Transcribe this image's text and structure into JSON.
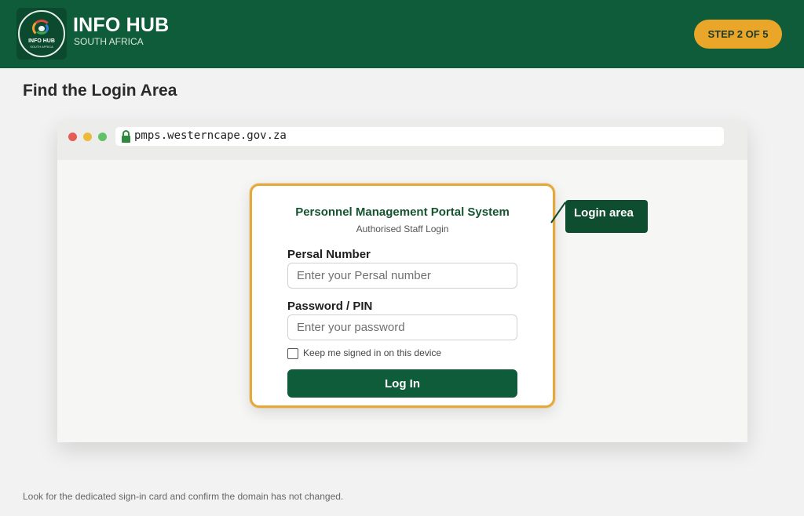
{
  "header": {
    "logo": {
      "icon": "info-hub-logo-icon",
      "text": "INFO HUB",
      "subtext": "SOUTH AFRICA"
    },
    "title": "INFO HUB",
    "subtitle": "SOUTH AFRICA",
    "step_badge": "STEP 2 OF 5"
  },
  "page": {
    "title": "Find the Login Area",
    "footer_note": "Look for the dedicated sign-in card and confirm the domain has not changed."
  },
  "browser": {
    "url": "pmps.westerncape.gov.za",
    "lock_icon": "lock-icon"
  },
  "login_card": {
    "title": "Personnel Management Portal System",
    "subtitle": "Authorised Staff Login",
    "persal": {
      "label": "Persal Number",
      "placeholder": "Enter your Persal number",
      "value": ""
    },
    "password": {
      "label": "Password / PIN",
      "placeholder": "Enter your password",
      "value": ""
    },
    "remember": {
      "label": "Keep me signed in on this device",
      "checked": false
    },
    "button": "Log In"
  },
  "callout": {
    "label": "Login area"
  },
  "colors": {
    "brand_green": "#0f5c3a",
    "accent_gold": "#e9a629",
    "highlight_border": "#e4a93a"
  }
}
